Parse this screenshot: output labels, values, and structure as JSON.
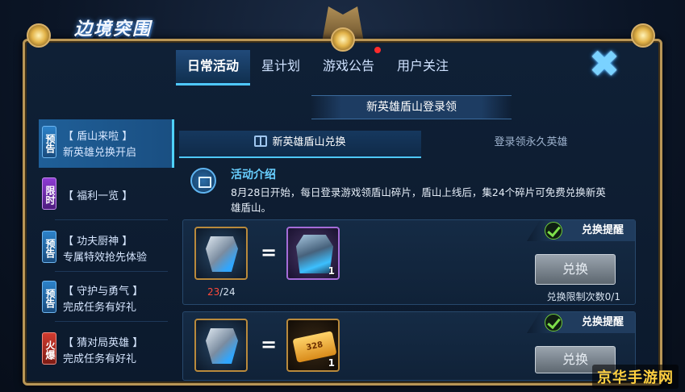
{
  "header": {
    "logo_text": "边境突围"
  },
  "tabs": [
    {
      "label": "日常活动",
      "active": true
    },
    {
      "label": "星计划",
      "active": false
    },
    {
      "label": "游戏公告",
      "active": false,
      "notification": true
    },
    {
      "label": "用户关注",
      "active": false
    }
  ],
  "close_icon": "close-icon",
  "sidebar": {
    "items": [
      {
        "badge": "预告",
        "title": "【 盾山来啦 】",
        "subtitle": "新英雄兑换开启",
        "active": true
      },
      {
        "badge": "限时",
        "title": "【 福利一览 】",
        "subtitle": "",
        "active": false
      },
      {
        "badge": "预告",
        "title": "【 功夫厨神 】",
        "subtitle": "专属特效抢先体验",
        "active": false
      },
      {
        "badge": "预告",
        "title": "【 守护与勇气 】",
        "subtitle": "完成任务有好礼",
        "active": false
      },
      {
        "badge": "火爆",
        "title": "【 猜对局英雄 】",
        "subtitle": "完成任务有好礼",
        "active": false
      }
    ]
  },
  "content": {
    "banner_title": "新英雄盾山登录领",
    "subtabs": [
      {
        "label": "新英雄盾山兑换",
        "active": true
      },
      {
        "label": "登录领永久英雄",
        "active": false
      }
    ],
    "intro": {
      "title": "活动介绍",
      "text": "8月28日开始，每日登录游戏领盾山碎片，盾山上线后，集24个碎片可免费兑换新英雄盾山。"
    },
    "exchanges": [
      {
        "reminder_label": "兑换提醒",
        "progress_current": "23",
        "progress_total": "/24",
        "reward_qty": "1",
        "button_label": "兑换",
        "limit_text": "兑换限制次数0/1"
      },
      {
        "reminder_label": "兑换提醒",
        "ticket_text": "328",
        "reward_qty": "1",
        "button_label": "兑换"
      }
    ],
    "equals_sign": "="
  },
  "watermark": "京华手游网",
  "colors": {
    "accent": "#4fc8ff",
    "gold_frame": "#b99656",
    "progress_red": "#ff4a3a"
  }
}
